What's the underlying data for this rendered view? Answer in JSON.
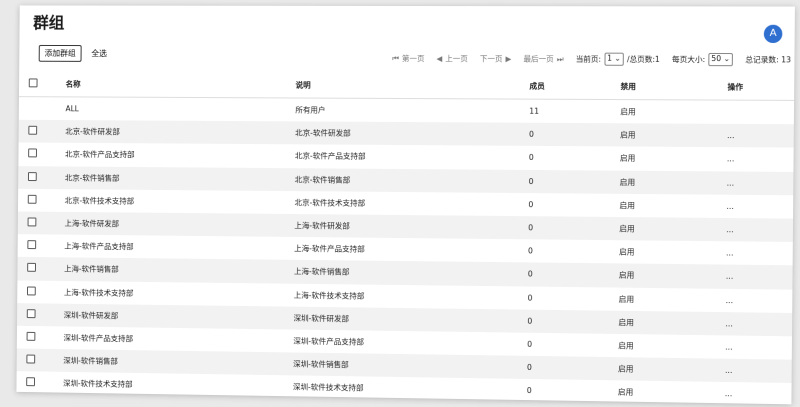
{
  "page": {
    "title": "群组",
    "avatar_letter": "A"
  },
  "toolbar": {
    "add_group": "添加群组",
    "select_all": "全选"
  },
  "pager": {
    "first": "第一页",
    "prev": "上一页",
    "next": "下一页",
    "last": "最后一页",
    "current_page_label": "当前页:",
    "current_page": "1",
    "total_pages": "/总页数:1",
    "page_size_label": "每页大小:",
    "page_size": "50",
    "total_records": "总记录数: 13"
  },
  "table": {
    "headers": {
      "name": "名称",
      "desc": "说明",
      "members": "成员",
      "disabled": "禁用",
      "actions": "操作"
    },
    "rows": [
      {
        "name": "ALL",
        "desc": "所有用户",
        "members": "11",
        "disabled": "启用",
        "actions": ""
      },
      {
        "name": "北京-软件研发部",
        "desc": "北京-软件研发部",
        "members": "0",
        "disabled": "启用",
        "actions": "..."
      },
      {
        "name": "北京-软件产品支持部",
        "desc": "北京-软件产品支持部",
        "members": "0",
        "disabled": "启用",
        "actions": "..."
      },
      {
        "name": "北京-软件销售部",
        "desc": "北京-软件销售部",
        "members": "0",
        "disabled": "启用",
        "actions": "..."
      },
      {
        "name": "北京-软件技术支持部",
        "desc": "北京-软件技术支持部",
        "members": "0",
        "disabled": "启用",
        "actions": "..."
      },
      {
        "name": "上海-软件研发部",
        "desc": "上海-软件研发部",
        "members": "0",
        "disabled": "启用",
        "actions": "..."
      },
      {
        "name": "上海-软件产品支持部",
        "desc": "上海-软件产品支持部",
        "members": "0",
        "disabled": "启用",
        "actions": "..."
      },
      {
        "name": "上海-软件销售部",
        "desc": "上海-软件销售部",
        "members": "0",
        "disabled": "启用",
        "actions": "..."
      },
      {
        "name": "上海-软件技术支持部",
        "desc": "上海-软件技术支持部",
        "members": "0",
        "disabled": "启用",
        "actions": "..."
      },
      {
        "name": "深圳-软件研发部",
        "desc": "深圳-软件研发部",
        "members": "0",
        "disabled": "启用",
        "actions": "..."
      },
      {
        "name": "深圳-软件产品支持部",
        "desc": "深圳-软件产品支持部",
        "members": "0",
        "disabled": "启用",
        "actions": "..."
      },
      {
        "name": "深圳-软件销售部",
        "desc": "深圳-软件销售部",
        "members": "0",
        "disabled": "启用",
        "actions": "..."
      },
      {
        "name": "深圳-软件技术支持部",
        "desc": "深圳-软件技术支持部",
        "members": "0",
        "disabled": "启用",
        "actions": "..."
      }
    ]
  }
}
